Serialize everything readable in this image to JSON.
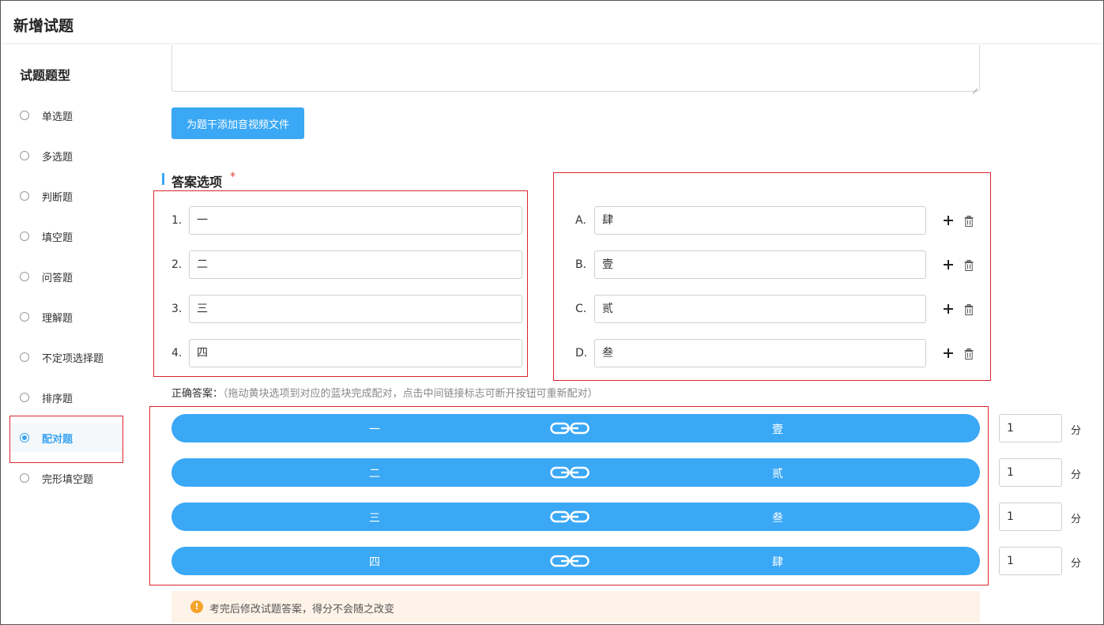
{
  "header": {
    "title": "新增试题"
  },
  "sidebar": {
    "title": "试题题型",
    "items": [
      {
        "label": "单选题",
        "selected": false
      },
      {
        "label": "多选题",
        "selected": false
      },
      {
        "label": "判断题",
        "selected": false
      },
      {
        "label": "填空题",
        "selected": false
      },
      {
        "label": "问答题",
        "selected": false
      },
      {
        "label": "理解题",
        "selected": false
      },
      {
        "label": "不定项选择题",
        "selected": false
      },
      {
        "label": "排序题",
        "selected": false
      },
      {
        "label": "配对题",
        "selected": true
      },
      {
        "label": "完形填空题",
        "selected": false
      }
    ]
  },
  "stem": {
    "add_media_button": "为题干添加音视频文件"
  },
  "answers": {
    "section_title": "答案选项",
    "required_mark": "*",
    "left_items": [
      {
        "index": "1.",
        "value": "一"
      },
      {
        "index": "2.",
        "value": "二"
      },
      {
        "index": "3.",
        "value": "三"
      },
      {
        "index": "4.",
        "value": "四"
      }
    ],
    "right_items": [
      {
        "index": "A.",
        "value": "肆"
      },
      {
        "index": "B.",
        "value": "壹"
      },
      {
        "index": "C.",
        "value": "贰"
      },
      {
        "index": "D.",
        "value": "叁"
      }
    ]
  },
  "correct": {
    "label": "正确答案：",
    "hint": "（拖动黄块选项到对应的蓝块完成配对，点击中间链接标志可断开按钮可重新配对）",
    "pairs": [
      {
        "left": "一",
        "right": "壹",
        "score": "1"
      },
      {
        "left": "二",
        "right": "贰",
        "score": "1"
      },
      {
        "left": "三",
        "right": "叁",
        "score": "1"
      },
      {
        "left": "四",
        "right": "肆",
        "score": "1"
      }
    ],
    "score_unit": "分"
  },
  "notice": {
    "text": "考完后修改试题答案，得分不会随之改变",
    "icon": "!"
  },
  "colors": {
    "accent": "#3aa8f5",
    "highlight_box": "#d9262e",
    "notice_bg": "#fef3e8",
    "warning": "#f5a32a"
  }
}
